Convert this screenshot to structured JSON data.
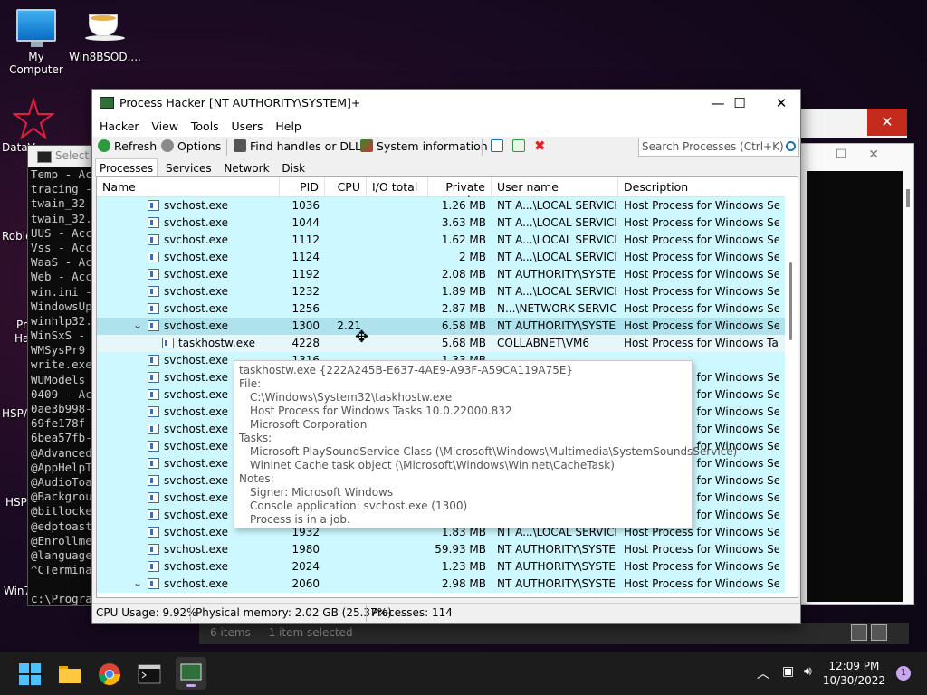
{
  "desktop": {
    "icons": [
      {
        "label": "My Computer"
      },
      {
        "label": "Win8BSOD...."
      }
    ],
    "left_labels": [
      "DataV",
      "Roblo",
      "Pr",
      "Ha",
      "HSP/",
      "HSP",
      "Win7"
    ]
  },
  "console": {
    "title": "Select A",
    "lines": [
      "Temp - Ac",
      "tracing -",
      "twain_32",
      "twain_32.",
      "UUS - Acc",
      "Vss - Acc",
      "WaaS - Ac",
      "Web - Acc",
      "win.ini -",
      "WindowsUp",
      "winhlp32.",
      "WinSxS - ",
      "WMSysPr9",
      "write.exe",
      "WUModels ",
      "0409 - Ac",
      "0ae3b998-",
      "69fe178f-",
      "6bea57fb-",
      "@Advanced",
      "@AppHelpT",
      "@AudioToa",
      "@Backgrou",
      "@bitlocke",
      "@edptoast",
      "@Enrollme",
      "@language",
      "^CTermina",
      "",
      "c:\\Progra"
    ]
  },
  "explorer_status": {
    "items": "6 items",
    "selected": "1 item selected"
  },
  "window": {
    "title": "Process Hacker [NT AUTHORITY\\SYSTEM]+",
    "minimize": "—",
    "maximize": "☐",
    "close": "✕",
    "menu": [
      "Hacker",
      "View",
      "Tools",
      "Users",
      "Help"
    ],
    "toolbar": {
      "refresh": "Refresh",
      "options": "Options",
      "find_handles": "Find handles or DLLs",
      "system_info": "System information"
    },
    "search_placeholder": "Search Processes (Ctrl+K)",
    "tabs": [
      "Processes",
      "Services",
      "Network",
      "Disk"
    ],
    "columns": [
      "Name",
      "PID",
      "CPU",
      "I/O total ...",
      "Private b...",
      "User name",
      "Description"
    ],
    "rows": [
      {
        "name": "svchost.exe",
        "pid": "1036",
        "cpu": "",
        "mem": "1.26 MB",
        "user": "NT A...\\LOCAL SERVICE",
        "desc": "Host Process for Windows Ser..."
      },
      {
        "name": "svchost.exe",
        "pid": "1044",
        "cpu": "",
        "mem": "3.63 MB",
        "user": "NT A...\\LOCAL SERVICE",
        "desc": "Host Process for Windows Ser..."
      },
      {
        "name": "svchost.exe",
        "pid": "1112",
        "cpu": "",
        "mem": "1.62 MB",
        "user": "NT A...\\LOCAL SERVICE",
        "desc": "Host Process for Windows Ser..."
      },
      {
        "name": "svchost.exe",
        "pid": "1124",
        "cpu": "",
        "mem": "2 MB",
        "user": "NT A...\\LOCAL SERVICE",
        "desc": "Host Process for Windows Ser..."
      },
      {
        "name": "svchost.exe",
        "pid": "1192",
        "cpu": "",
        "mem": "2.08 MB",
        "user": "NT AUTHORITY\\SYSTEM",
        "desc": "Host Process for Windows Ser..."
      },
      {
        "name": "svchost.exe",
        "pid": "1232",
        "cpu": "",
        "mem": "1.89 MB",
        "user": "NT A...\\LOCAL SERVICE",
        "desc": "Host Process for Windows Ser..."
      },
      {
        "name": "svchost.exe",
        "pid": "1256",
        "cpu": "",
        "mem": "2.87 MB",
        "user": "N...\\NETWORK SERVICE",
        "desc": "Host Process for Windows Ser..."
      },
      {
        "name": "svchost.exe",
        "pid": "1300",
        "cpu": "2.21",
        "mem": "6.58 MB",
        "user": "NT AUTHORITY\\SYSTEM",
        "desc": "Host Process for Windows Ser...",
        "expanded": true,
        "selected": true
      },
      {
        "name": "taskhostw.exe",
        "pid": "4228",
        "cpu": "",
        "mem": "5.68 MB",
        "user": "COLLABNET\\VM6",
        "desc": "Host Process for Windows Tasks",
        "child": true
      },
      {
        "name": "svchost.exe",
        "pid": "1316",
        "cpu": "",
        "mem": "1.33 MB",
        "user": "",
        "desc": ""
      },
      {
        "name": "svchost.exe",
        "pid": "",
        "cpu": "",
        "mem": "",
        "user": "",
        "desc": "Host Process for Windows Ser..."
      },
      {
        "name": "svchost.exe",
        "pid": "",
        "cpu": "",
        "mem": "",
        "user": "",
        "desc": "Host Process for Windows Ser..."
      },
      {
        "name": "svchost.exe",
        "pid": "",
        "cpu": "",
        "mem": "",
        "user": "",
        "desc": "Host Process for Windows Ser..."
      },
      {
        "name": "svchost.exe",
        "pid": "",
        "cpu": "",
        "mem": "",
        "user": "",
        "desc": "Host Process for Windows Ser..."
      },
      {
        "name": "svchost.exe",
        "pid": "",
        "cpu": "",
        "mem": "",
        "user": "",
        "desc": "Host Process for Windows Ser..."
      },
      {
        "name": "svchost.exe",
        "pid": "",
        "cpu": "",
        "mem": "",
        "user": "",
        "desc": "Host Process for Windows Ser..."
      },
      {
        "name": "svchost.exe",
        "pid": "",
        "cpu": "",
        "mem": "",
        "user": "",
        "desc": "Host Process for Windows Ser..."
      },
      {
        "name": "svchost.exe",
        "pid": "",
        "cpu": "",
        "mem": "",
        "user": "",
        "desc": "Host Process for Windows Ser..."
      },
      {
        "name": "svchost.exe",
        "pid": "",
        "cpu": "",
        "mem": "",
        "user": "",
        "desc": "Host Process for Windows Ser..."
      },
      {
        "name": "svchost.exe",
        "pid": "1932",
        "cpu": "",
        "mem": "1.83 MB",
        "user": "NT A...\\LOCAL SERVICE",
        "desc": "Host Process for Windows Ser..."
      },
      {
        "name": "svchost.exe",
        "pid": "1980",
        "cpu": "",
        "mem": "59.93 MB",
        "user": "NT AUTHORITY\\SYSTEM",
        "desc": "Host Process for Windows Ser..."
      },
      {
        "name": "svchost.exe",
        "pid": "2024",
        "cpu": "",
        "mem": "1.23 MB",
        "user": "NT AUTHORITY\\SYSTEM",
        "desc": "Host Process for Windows Ser..."
      },
      {
        "name": "svchost.exe",
        "pid": "2060",
        "cpu": "",
        "mem": "2.98 MB",
        "user": "NT AUTHORITY\\SYSTEM",
        "desc": "Host Process for Windows Ser...",
        "expanded": true
      }
    ],
    "status": {
      "cpu": "CPU Usage: 9.92%",
      "memory": "Physical memory: 2.02 GB (25.37%)",
      "processes": "Processes: 114"
    }
  },
  "tooltip": {
    "lines": [
      {
        "text": "taskhostw.exe {222A245B-E637-4AE9-A93F-A59CA119A75E}",
        "indent": false
      },
      {
        "text": "File:",
        "indent": false
      },
      {
        "text": "C:\\Windows\\System32\\taskhostw.exe",
        "indent": true
      },
      {
        "text": "Host Process for Windows Tasks 10.0.22000.832",
        "indent": true
      },
      {
        "text": "Microsoft Corporation",
        "indent": true
      },
      {
        "text": "Tasks:",
        "indent": false
      },
      {
        "text": "Microsoft PlaySoundService Class (\\Microsoft\\Windows\\Multimedia\\SystemSoundsService)",
        "indent": true
      },
      {
        "text": "Wininet Cache task object (\\Microsoft\\Windows\\Wininet\\CacheTask)",
        "indent": true
      },
      {
        "text": "Notes:",
        "indent": false
      },
      {
        "text": "Signer: Microsoft Windows",
        "indent": true
      },
      {
        "text": "Console application: svchost.exe (1300)",
        "indent": true
      },
      {
        "text": "Process is in a job.",
        "indent": true
      }
    ]
  },
  "taskbar": {
    "time": "12:09 PM",
    "date": "10/30/2022",
    "notifications": "1"
  }
}
